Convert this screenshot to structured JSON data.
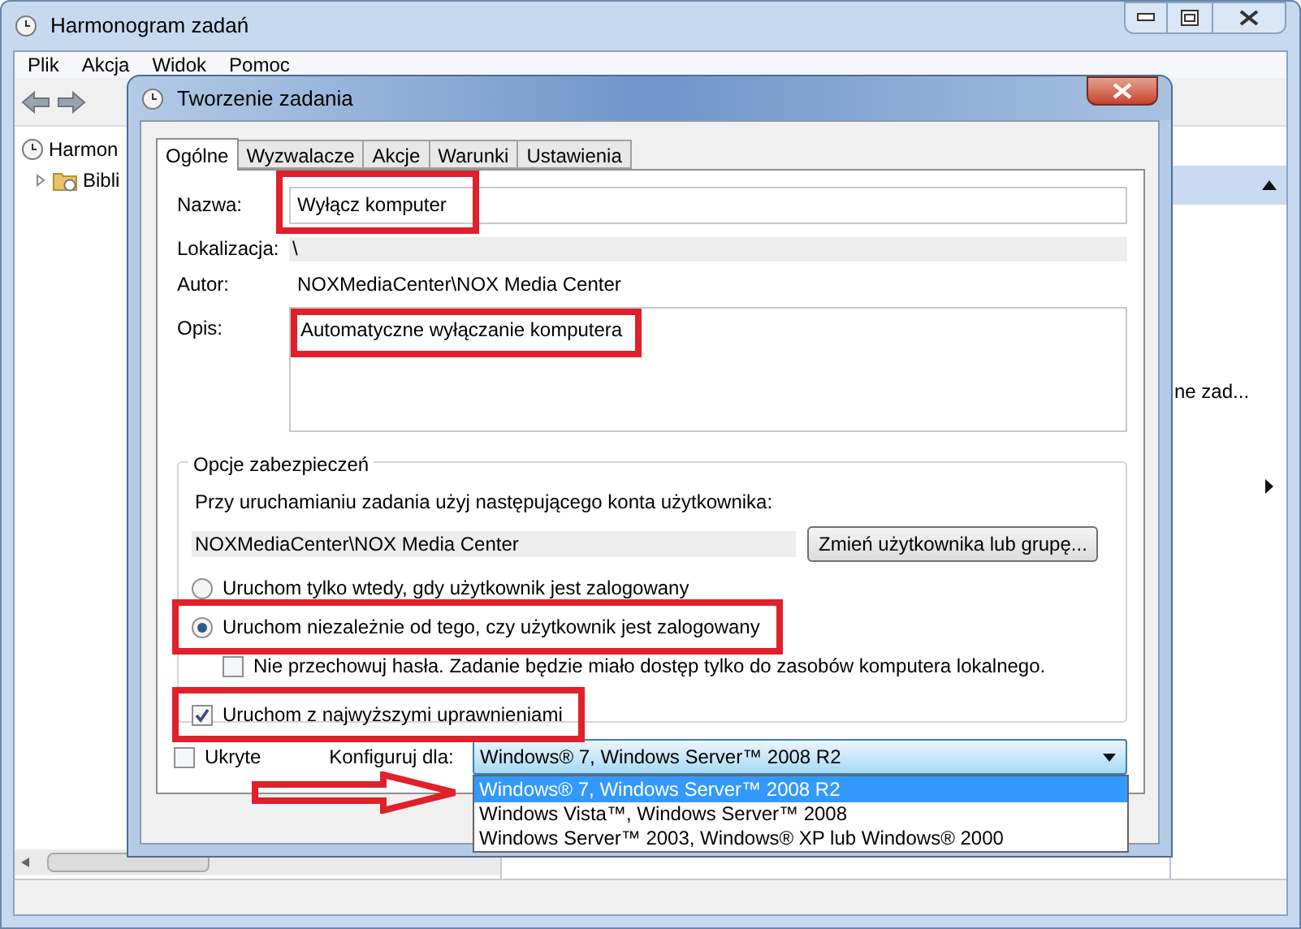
{
  "main_window": {
    "title": "Harmonogram zadań",
    "menu": [
      "Plik",
      "Akcja",
      "Widok",
      "Pomoc"
    ],
    "tree": [
      {
        "label": "Harmon",
        "children": [
          {
            "label": "Bibli",
            "expanded": false
          }
        ]
      }
    ],
    "actions_panel": {
      "items": [
        {
          "label": "ne zad..."
        }
      ]
    }
  },
  "dialog": {
    "title": "Tworzenie zadania",
    "tabs": [
      {
        "label": "Ogólne",
        "selected": true
      },
      {
        "label": "Wyzwalacze",
        "selected": false
      },
      {
        "label": "Akcje",
        "selected": false
      },
      {
        "label": "Warunki",
        "selected": false
      },
      {
        "label": "Ustawienia",
        "selected": false
      }
    ],
    "name": {
      "label": "Nazwa:",
      "value": "Wyłącz komputer",
      "highlighted": true
    },
    "location": {
      "label": "Lokalizacja:",
      "value": "\\"
    },
    "author": {
      "label": "Autor:",
      "value": "NOXMediaCenter\\NOX Media Center"
    },
    "description": {
      "label": "Opis:",
      "value": "Automatyczne wyłączanie komputera",
      "highlighted": true
    },
    "security": {
      "title": "Opcje zabezpieczeń",
      "account_prompt": "Przy uruchamianiu zadania użyj następującego konta użytkownika:",
      "account": "NOXMediaCenter\\NOX Media Center",
      "change_button": "Zmień użytkownika lub grupę...",
      "options": [
        {
          "kind": "radio",
          "label": "Uruchom tylko wtedy, gdy użytkownik jest zalogowany",
          "selected": false
        },
        {
          "kind": "radio",
          "label": "Uruchom niezależnie od tego, czy użytkownik jest zalogowany",
          "selected": true,
          "highlighted": true
        },
        {
          "kind": "sub_checkbox",
          "label": "Nie przechowuj hasła. Zadanie będzie miało dostęp tylko do zasobów komputera lokalnego.",
          "checked": false
        },
        {
          "kind": "checkbox",
          "label": "Uruchom z najwyższymi uprawnieniami",
          "checked": true,
          "highlighted": true
        }
      ]
    },
    "hidden": {
      "label": "Ukryte",
      "checked": false
    },
    "configure_for": {
      "label": "Konfiguruj dla:",
      "value": "Windows® 7, Windows Server™ 2008 R2",
      "arrow_marked": true,
      "expanded": true,
      "options": [
        {
          "label": "Windows® 7, Windows Server™ 2008 R2",
          "selected": true
        },
        {
          "label": "Windows Vista™, Windows Server™ 2008",
          "selected": false
        },
        {
          "label": "Windows Server™ 2003, Windows® XP lub Windows® 2000",
          "selected": false
        }
      ]
    }
  }
}
